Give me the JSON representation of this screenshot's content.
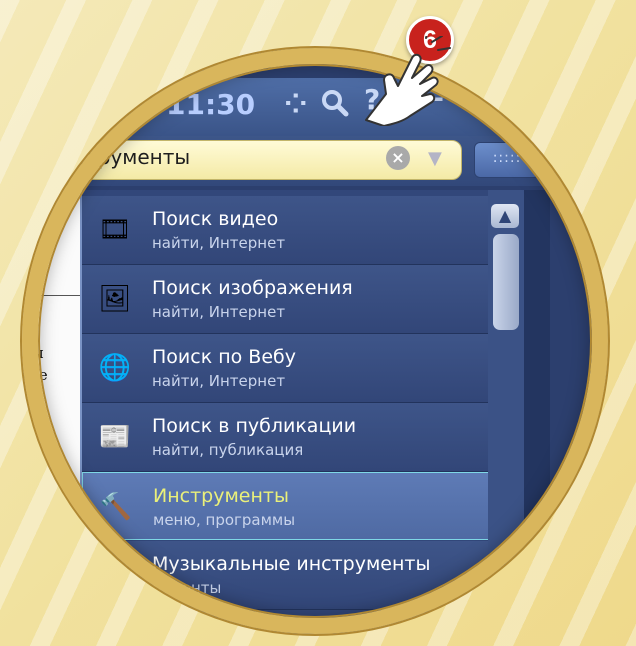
{
  "badge": {
    "number": "6"
  },
  "toolbar": {
    "time": "11:30"
  },
  "search": {
    "value": "нструменты",
    "keyboard_label": ":::::"
  },
  "document": {
    "lines": [
      "цы",
      "сте",
      "од"
    ]
  },
  "list": {
    "items": [
      {
        "title": "Поиск видео",
        "subtitle": "найти, Интернет",
        "icon": "video-search-icon",
        "glyph": "🎞"
      },
      {
        "title": "Поиск изображения",
        "subtitle": "найти, Интернет",
        "icon": "image-search-icon",
        "glyph": "🖼"
      },
      {
        "title": "Поиск по Вебу",
        "subtitle": "найти, Интернет",
        "icon": "web-search-icon",
        "glyph": "🌐"
      },
      {
        "title": "Поиск в публикации",
        "subtitle": "найти, публикация",
        "icon": "publication-search-icon",
        "glyph": "📰"
      },
      {
        "title": "Инструменты",
        "subtitle": "меню, программы",
        "icon": "hammer-icon",
        "glyph": "🔨"
      },
      {
        "title": "Музыкальные инструменты",
        "subtitle": "рументы",
        "icon": "music-icon",
        "glyph": ""
      }
    ]
  },
  "colors": {
    "accent_ring": "#d9b65c",
    "badge": "#c8221d",
    "selected_title": "#eaf07a",
    "list_bg": "#32477a"
  }
}
